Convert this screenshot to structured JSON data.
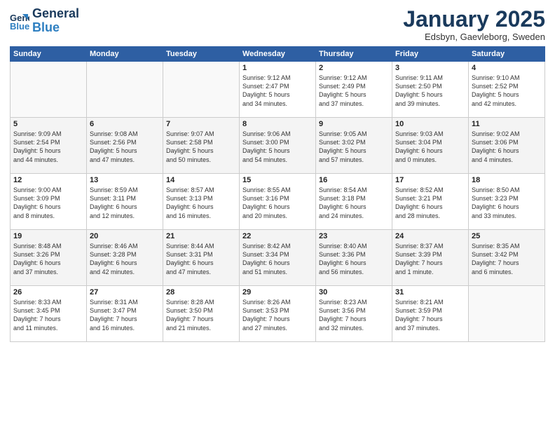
{
  "logo": {
    "line1": "General",
    "line2": "Blue"
  },
  "title": "January 2025",
  "subtitle": "Edsbyn, Gaevleborg, Sweden",
  "days_header": [
    "Sunday",
    "Monday",
    "Tuesday",
    "Wednesday",
    "Thursday",
    "Friday",
    "Saturday"
  ],
  "weeks": [
    [
      {
        "day": "",
        "text": ""
      },
      {
        "day": "",
        "text": ""
      },
      {
        "day": "",
        "text": ""
      },
      {
        "day": "1",
        "text": "Sunrise: 9:12 AM\nSunset: 2:47 PM\nDaylight: 5 hours\nand 34 minutes."
      },
      {
        "day": "2",
        "text": "Sunrise: 9:12 AM\nSunset: 2:49 PM\nDaylight: 5 hours\nand 37 minutes."
      },
      {
        "day": "3",
        "text": "Sunrise: 9:11 AM\nSunset: 2:50 PM\nDaylight: 5 hours\nand 39 minutes."
      },
      {
        "day": "4",
        "text": "Sunrise: 9:10 AM\nSunset: 2:52 PM\nDaylight: 5 hours\nand 42 minutes."
      }
    ],
    [
      {
        "day": "5",
        "text": "Sunrise: 9:09 AM\nSunset: 2:54 PM\nDaylight: 5 hours\nand 44 minutes."
      },
      {
        "day": "6",
        "text": "Sunrise: 9:08 AM\nSunset: 2:56 PM\nDaylight: 5 hours\nand 47 minutes."
      },
      {
        "day": "7",
        "text": "Sunrise: 9:07 AM\nSunset: 2:58 PM\nDaylight: 5 hours\nand 50 minutes."
      },
      {
        "day": "8",
        "text": "Sunrise: 9:06 AM\nSunset: 3:00 PM\nDaylight: 5 hours\nand 54 minutes."
      },
      {
        "day": "9",
        "text": "Sunrise: 9:05 AM\nSunset: 3:02 PM\nDaylight: 5 hours\nand 57 minutes."
      },
      {
        "day": "10",
        "text": "Sunrise: 9:03 AM\nSunset: 3:04 PM\nDaylight: 6 hours\nand 0 minutes."
      },
      {
        "day": "11",
        "text": "Sunrise: 9:02 AM\nSunset: 3:06 PM\nDaylight: 6 hours\nand 4 minutes."
      }
    ],
    [
      {
        "day": "12",
        "text": "Sunrise: 9:00 AM\nSunset: 3:09 PM\nDaylight: 6 hours\nand 8 minutes."
      },
      {
        "day": "13",
        "text": "Sunrise: 8:59 AM\nSunset: 3:11 PM\nDaylight: 6 hours\nand 12 minutes."
      },
      {
        "day": "14",
        "text": "Sunrise: 8:57 AM\nSunset: 3:13 PM\nDaylight: 6 hours\nand 16 minutes."
      },
      {
        "day": "15",
        "text": "Sunrise: 8:55 AM\nSunset: 3:16 PM\nDaylight: 6 hours\nand 20 minutes."
      },
      {
        "day": "16",
        "text": "Sunrise: 8:54 AM\nSunset: 3:18 PM\nDaylight: 6 hours\nand 24 minutes."
      },
      {
        "day": "17",
        "text": "Sunrise: 8:52 AM\nSunset: 3:21 PM\nDaylight: 6 hours\nand 28 minutes."
      },
      {
        "day": "18",
        "text": "Sunrise: 8:50 AM\nSunset: 3:23 PM\nDaylight: 6 hours\nand 33 minutes."
      }
    ],
    [
      {
        "day": "19",
        "text": "Sunrise: 8:48 AM\nSunset: 3:26 PM\nDaylight: 6 hours\nand 37 minutes."
      },
      {
        "day": "20",
        "text": "Sunrise: 8:46 AM\nSunset: 3:28 PM\nDaylight: 6 hours\nand 42 minutes."
      },
      {
        "day": "21",
        "text": "Sunrise: 8:44 AM\nSunset: 3:31 PM\nDaylight: 6 hours\nand 47 minutes."
      },
      {
        "day": "22",
        "text": "Sunrise: 8:42 AM\nSunset: 3:34 PM\nDaylight: 6 hours\nand 51 minutes."
      },
      {
        "day": "23",
        "text": "Sunrise: 8:40 AM\nSunset: 3:36 PM\nDaylight: 6 hours\nand 56 minutes."
      },
      {
        "day": "24",
        "text": "Sunrise: 8:37 AM\nSunset: 3:39 PM\nDaylight: 7 hours\nand 1 minute."
      },
      {
        "day": "25",
        "text": "Sunrise: 8:35 AM\nSunset: 3:42 PM\nDaylight: 7 hours\nand 6 minutes."
      }
    ],
    [
      {
        "day": "26",
        "text": "Sunrise: 8:33 AM\nSunset: 3:45 PM\nDaylight: 7 hours\nand 11 minutes."
      },
      {
        "day": "27",
        "text": "Sunrise: 8:31 AM\nSunset: 3:47 PM\nDaylight: 7 hours\nand 16 minutes."
      },
      {
        "day": "28",
        "text": "Sunrise: 8:28 AM\nSunset: 3:50 PM\nDaylight: 7 hours\nand 21 minutes."
      },
      {
        "day": "29",
        "text": "Sunrise: 8:26 AM\nSunset: 3:53 PM\nDaylight: 7 hours\nand 27 minutes."
      },
      {
        "day": "30",
        "text": "Sunrise: 8:23 AM\nSunset: 3:56 PM\nDaylight: 7 hours\nand 32 minutes."
      },
      {
        "day": "31",
        "text": "Sunrise: 8:21 AM\nSunset: 3:59 PM\nDaylight: 7 hours\nand 37 minutes."
      },
      {
        "day": "",
        "text": ""
      }
    ]
  ]
}
